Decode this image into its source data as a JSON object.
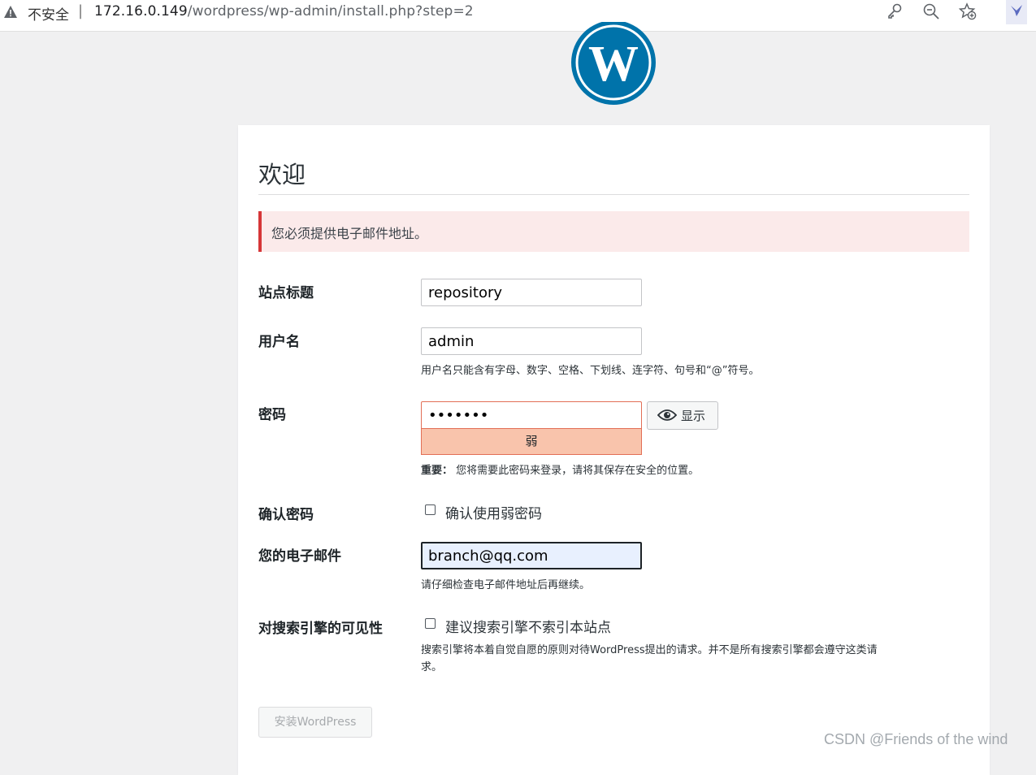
{
  "browser": {
    "security_label": "不安全",
    "separator": "|",
    "url_host": "172.16.0.149",
    "url_path": "/wordpress/wp-admin/install.php?step=2",
    "icons": [
      "warning-icon",
      "key-icon",
      "zoom-out-icon",
      "favorite-star-icon",
      "extension-icon"
    ]
  },
  "page": {
    "title": "欢迎",
    "error_notice": "您必须提供电子邮件地址。"
  },
  "form": {
    "site_title": {
      "label": "站点标题",
      "value": "repository"
    },
    "username": {
      "label": "用户名",
      "value": "admin",
      "hint": "用户名只能含有字母、数字、空格、下划线、连字符、句号和“@”符号。"
    },
    "password": {
      "label": "密码",
      "value": "•••••••",
      "strength": "弱",
      "show_label": "显示",
      "hint_bold": "重要：",
      "hint": "您将需要此密码来登录，请将其保存在安全的位置。"
    },
    "confirm_password": {
      "label": "确认密码",
      "checkbox_label": "确认使用弱密码",
      "checked": false
    },
    "email": {
      "label": "您的电子邮件",
      "value": "branch@qq.com",
      "hint": "请仔细检查电子邮件地址后再继续。"
    },
    "search_visibility": {
      "label": "对搜索引擎的可见性",
      "checkbox_label": "建议搜索引擎不索引本站点",
      "checked": false,
      "hint_line1": "搜索引擎将本着自觉自愿的原则对待WordPress提出的请求。并不是所有搜索引擎都会遵守这类请",
      "hint_line2": "求。"
    },
    "submit_label": "安装WordPress"
  },
  "watermark": "CSDN @Friends of the wind",
  "colors": {
    "wp_blue": "#0073aa",
    "error_red": "#d63638",
    "weak_meter": "#f9c4ac",
    "email_bg": "#e8f0fe"
  }
}
